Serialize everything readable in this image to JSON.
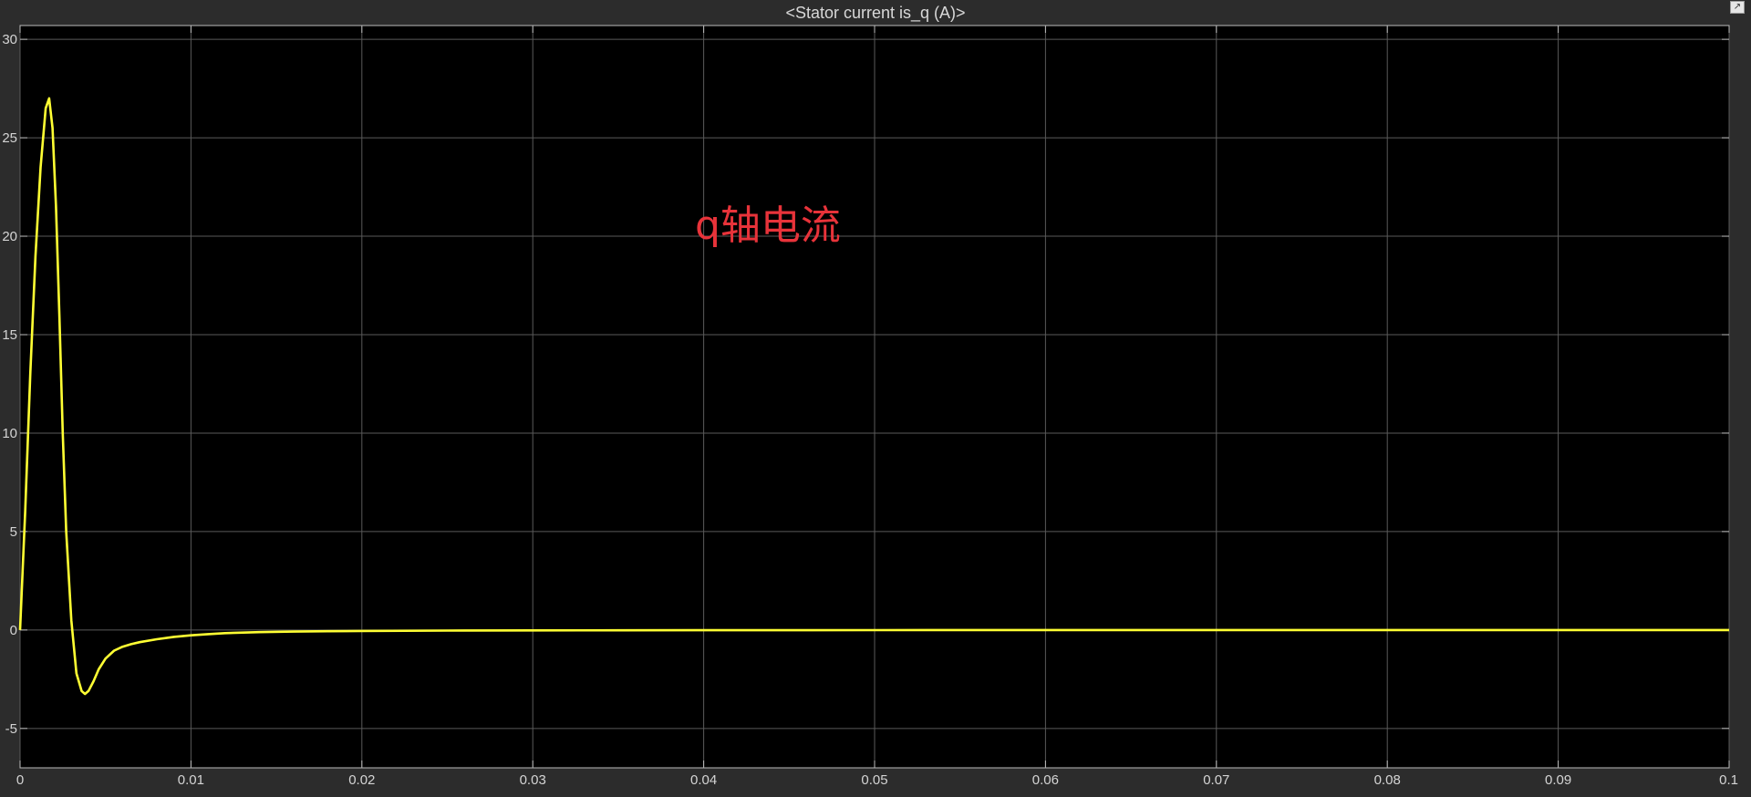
{
  "window": {
    "title": "<Stator current is_q (A)>",
    "undock_icon": "undock-arrow-icon"
  },
  "annotation": {
    "text": "q轴电流",
    "color": "#e8333a"
  },
  "colors": {
    "background": "#2c2c2c",
    "plot_area": "#000000",
    "grid": "#5a5a5a",
    "signal": "#ffff33",
    "tick_text": "#d4d4d4"
  },
  "chart_data": {
    "type": "line",
    "title": "<Stator current is_q (A)>",
    "xlabel": "",
    "ylabel": "",
    "xlim": [
      0,
      0.1
    ],
    "ylim": [
      -7,
      30.7
    ],
    "grid": true,
    "xticks": [
      0,
      0.01,
      0.02,
      0.03,
      0.04,
      0.05,
      0.06,
      0.07,
      0.08,
      0.09,
      0.1
    ],
    "xtick_labels": [
      "0",
      "0.01",
      "0.02",
      "0.03",
      "0.04",
      "0.05",
      "0.06",
      "0.07",
      "0.08",
      "0.09",
      "0.1"
    ],
    "yticks": [
      -5,
      0,
      5,
      10,
      15,
      20,
      25,
      30
    ],
    "ytick_labels": [
      "-5",
      "0",
      "5",
      "10",
      "15",
      "20",
      "25",
      "30"
    ],
    "series": [
      {
        "color": "#ffff33",
        "x": [
          0,
          0.0003,
          0.0006,
          0.0009,
          0.0012,
          0.0015,
          0.0017,
          0.0019,
          0.0021,
          0.0023,
          0.0025,
          0.0027,
          0.003,
          0.0033,
          0.0036,
          0.0038,
          0.004,
          0.0043,
          0.0046,
          0.005,
          0.0055,
          0.006,
          0.0065,
          0.007,
          0.008,
          0.009,
          0.01,
          0.011,
          0.012,
          0.014,
          0.016,
          0.018,
          0.02,
          0.025,
          0.03,
          0.035,
          0.04,
          0.05,
          0.06,
          0.07,
          0.08,
          0.09,
          0.1
        ],
        "y": [
          0,
          6,
          13,
          19,
          23.5,
          26.5,
          27,
          25.5,
          21.5,
          16,
          10,
          5,
          0.5,
          -2.2,
          -3.1,
          -3.25,
          -3.1,
          -2.6,
          -2.0,
          -1.45,
          -1.05,
          -0.85,
          -0.72,
          -0.62,
          -0.47,
          -0.35,
          -0.27,
          -0.21,
          -0.16,
          -0.11,
          -0.08,
          -0.06,
          -0.05,
          -0.03,
          -0.02,
          -0.015,
          -0.01,
          -0.005,
          0,
          0,
          0,
          0,
          0
        ]
      }
    ]
  }
}
